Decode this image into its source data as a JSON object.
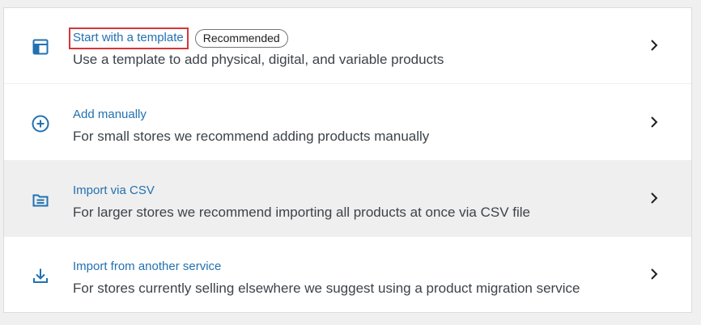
{
  "options": [
    {
      "title": "Start with a template",
      "badge": "Recommended",
      "description": "Use a template to add physical, digital, and variable products",
      "icon": "layout-template-icon"
    },
    {
      "title": "Add manually",
      "description": "For small stores we recommend adding products manually",
      "icon": "plus-circle-icon"
    },
    {
      "title": "Import via CSV",
      "description": "For larger stores we recommend importing all products at once via CSV file",
      "icon": "csv-file-icon"
    },
    {
      "title": "Import from another service",
      "description": "For stores currently selling elsewhere we suggest using a product migration service",
      "icon": "download-icon"
    }
  ],
  "colors": {
    "link": "#2271b1",
    "highlight_border": "#d63638",
    "hover_row": "#efefef"
  }
}
